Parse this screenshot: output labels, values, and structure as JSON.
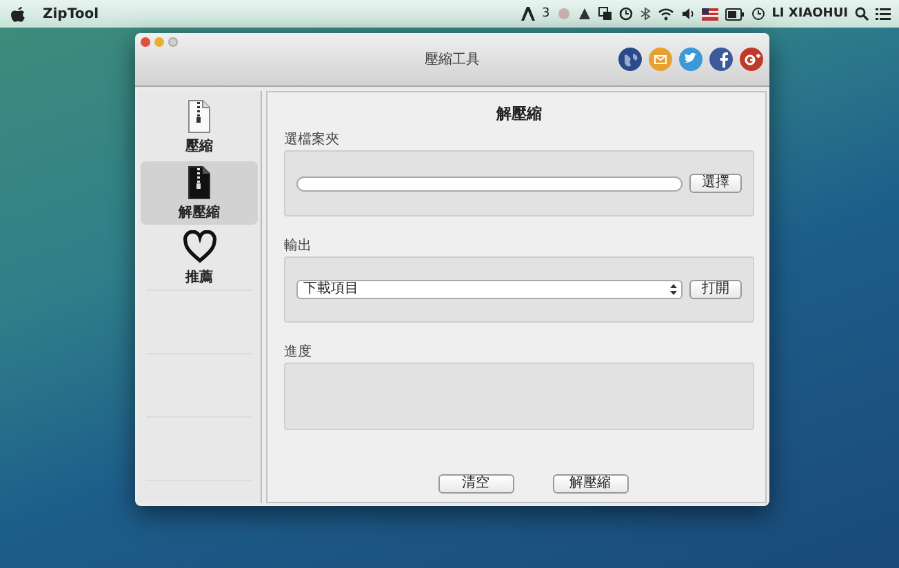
{
  "menu_bar": {
    "app_name": "ZipTool",
    "badge_count": "3",
    "user": "LI XIAOHUI"
  },
  "window": {
    "title": "壓縮工具"
  },
  "social_icons": [
    {
      "kind": "globe",
      "color": "#2a4a8a"
    },
    {
      "kind": "mail",
      "color": "#e8a030"
    },
    {
      "kind": "bird",
      "color": "#3a9ad8"
    },
    {
      "kind": "f",
      "color": "#3b5a9a"
    },
    {
      "kind": "g",
      "color": "#c03a2a"
    }
  ],
  "sidebar": {
    "items": [
      {
        "label": "壓縮",
        "kind": "zip-light",
        "selected": false
      },
      {
        "label": "解壓縮",
        "kind": "zip-dark",
        "selected": true
      },
      {
        "label": "推薦",
        "kind": "heart",
        "selected": false
      }
    ]
  },
  "content": {
    "heading": "解壓縮",
    "folder_group": {
      "label": "選檔案夾",
      "button": "選擇"
    },
    "output_group": {
      "label": "輸出",
      "value": "下載項目",
      "button": "打開"
    },
    "progress_group": {
      "label": "進度"
    },
    "buttons": [
      "清空",
      "解壓縮"
    ]
  }
}
